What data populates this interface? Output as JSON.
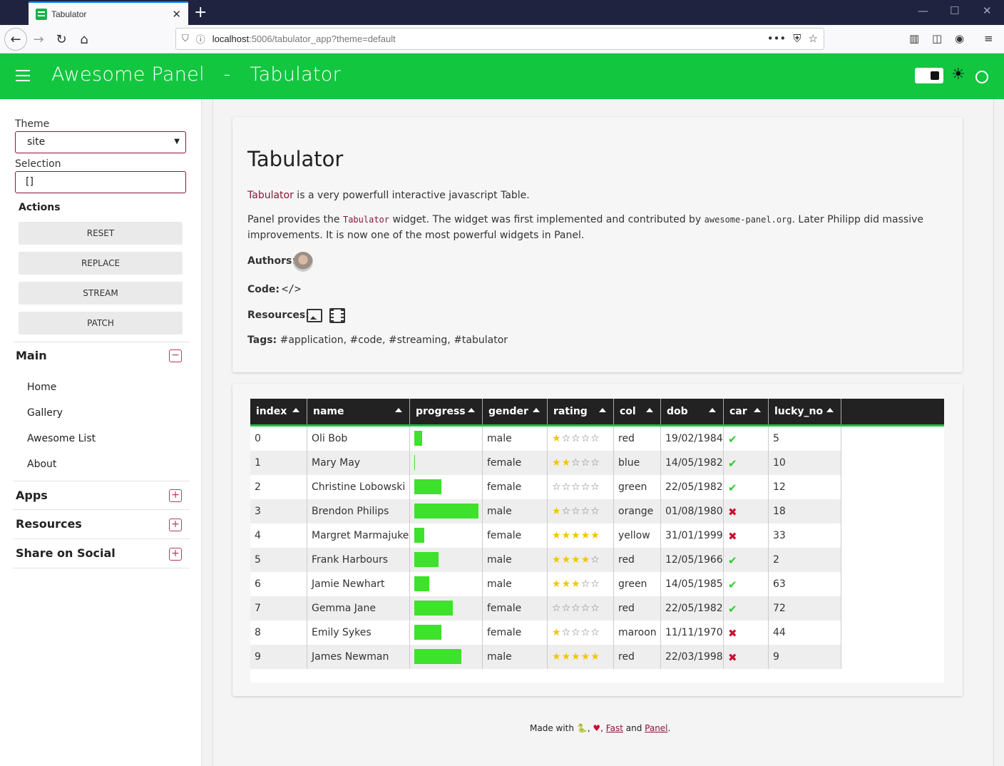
{
  "browser": {
    "tab_title": "Tabulator",
    "url_host": "localhost",
    "url_rest": ":5006/tabulator_app?theme=default"
  },
  "header": {
    "title": "Awesome Panel",
    "separator": "-",
    "subtitle": "Tabulator"
  },
  "sidebar": {
    "theme_label": "Theme",
    "theme_value": "site",
    "selection_label": "Selection",
    "selection_value": "[]",
    "actions_label": "Actions",
    "buttons": [
      "RESET",
      "REPLACE",
      "STREAM",
      "PATCH"
    ],
    "main_section": "Main",
    "main_items": [
      "Home",
      "Gallery",
      "Awesome List",
      "About"
    ],
    "sections": [
      "Apps",
      "Resources",
      "Share on Social"
    ]
  },
  "content": {
    "title": "Tabulator",
    "intro_link": "Tabulator",
    "intro_rest": " is a very powerfull interactive javascript Table.",
    "p2_a": "Panel provides the ",
    "p2_code": "Tabulator",
    "p2_b": " widget. The widget was first implemented and contributed by ",
    "p2_code2": "awesome-panel.org",
    "p2_c": ". Later Philipp did massive",
    "p2_line2": "improvements. It is now one of the most powerful widgets in Panel.",
    "authors_label": "Authors:",
    "code_label": "Code:",
    "resources_label": "Resources:",
    "tags_label": "Tags:",
    "tags": "#application, #code, #streaming, #tabulator"
  },
  "table": {
    "columns": [
      "index",
      "name",
      "progress",
      "gender",
      "rating",
      "col",
      "dob",
      "car",
      "lucky_no"
    ],
    "rows": [
      {
        "index": "0",
        "name": "Oli Bob",
        "progress": 12,
        "gender": "male",
        "rating": 1,
        "col": "red",
        "dob": "19/02/1984",
        "car": true,
        "lucky_no": "5"
      },
      {
        "index": "1",
        "name": "Mary May",
        "progress": 1,
        "gender": "female",
        "rating": 2,
        "col": "blue",
        "dob": "14/05/1982",
        "car": true,
        "lucky_no": "10"
      },
      {
        "index": "2",
        "name": "Christine Lobowski",
        "progress": 42,
        "gender": "female",
        "rating": 0,
        "col": "green",
        "dob": "22/05/1982",
        "car": true,
        "lucky_no": "12"
      },
      {
        "index": "3",
        "name": "Brendon Philips",
        "progress": 100,
        "gender": "male",
        "rating": 1,
        "col": "orange",
        "dob": "01/08/1980",
        "car": false,
        "lucky_no": "18"
      },
      {
        "index": "4",
        "name": "Margret Marmajuke",
        "progress": 16,
        "gender": "female",
        "rating": 5,
        "col": "yellow",
        "dob": "31/01/1999",
        "car": false,
        "lucky_no": "33"
      },
      {
        "index": "5",
        "name": "Frank Harbours",
        "progress": 38,
        "gender": "male",
        "rating": 4,
        "col": "red",
        "dob": "12/05/1966",
        "car": true,
        "lucky_no": "2"
      },
      {
        "index": "6",
        "name": "Jamie Newhart",
        "progress": 23,
        "gender": "male",
        "rating": 3,
        "col": "green",
        "dob": "14/05/1985",
        "car": true,
        "lucky_no": "63"
      },
      {
        "index": "7",
        "name": "Gemma Jane",
        "progress": 60,
        "gender": "female",
        "rating": 0,
        "col": "red",
        "dob": "22/05/1982",
        "car": true,
        "lucky_no": "72"
      },
      {
        "index": "8",
        "name": "Emily Sykes",
        "progress": 42,
        "gender": "female",
        "rating": 1,
        "col": "maroon",
        "dob": "11/11/1970",
        "car": false,
        "lucky_no": "44"
      },
      {
        "index": "9",
        "name": "James Newman",
        "progress": 73,
        "gender": "male",
        "rating": 5,
        "col": "red",
        "dob": "22/03/1998",
        "car": false,
        "lucky_no": "9"
      }
    ]
  },
  "footer": {
    "made_with": "Made with ",
    "sep1": ", ",
    "fast": "Fast",
    "and": " and ",
    "panel": "Panel",
    "end": "."
  },
  "colors": {
    "accent": "#12c640",
    "link": "#8a1538",
    "progress": "#3ee12b",
    "star_on": "#f2c500"
  },
  "icons": [
    "menu-icon",
    "theme-toggle-icon",
    "sun-icon",
    "circle-icon",
    "minus-icon",
    "plus-icon",
    "code-icon",
    "image-icon",
    "film-icon",
    "snake-icon",
    "heart-icon",
    "check-icon",
    "cross-icon",
    "star-icon"
  ]
}
